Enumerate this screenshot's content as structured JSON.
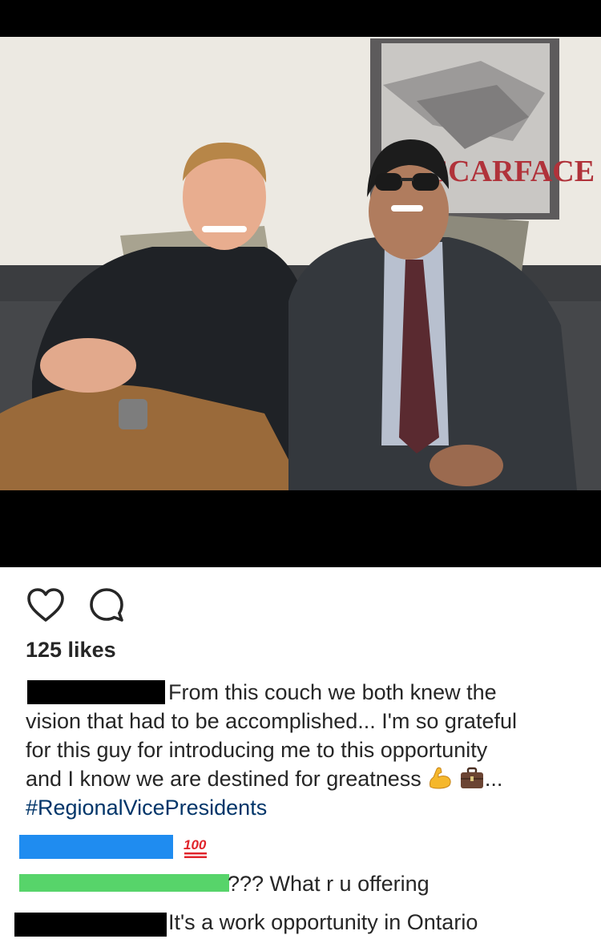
{
  "photo": {
    "poster_text": "SCARFACE"
  },
  "actions": {
    "like_icon": "heart-outline-icon",
    "comment_icon": "speech-bubble-icon"
  },
  "likes_text": "125 likes",
  "caption": {
    "line1": "From this couch we both knew the",
    "line2": "vision that had to be accomplished... I'm so grateful",
    "line3": "for this guy for introducing me to this opportunity",
    "line4": "and I know we are destined for greatness",
    "line4_tail": "...",
    "emojis": [
      "flexed-biceps-emoji",
      "briefcase-emoji"
    ],
    "hashtag": "#RegionalVicePresidents"
  },
  "comments": [
    {
      "emoji": "hundred-points-emoji",
      "emoji_text": "100"
    },
    {
      "text": "??? What r u offering"
    },
    {
      "text": "It's a work opportunity in Ontario"
    }
  ],
  "colors": {
    "hashtag": "#003569",
    "redaction_blue": "#1f8cf0",
    "redaction_green": "#57d46a",
    "redaction_black": "#000000",
    "text": "#262626"
  }
}
